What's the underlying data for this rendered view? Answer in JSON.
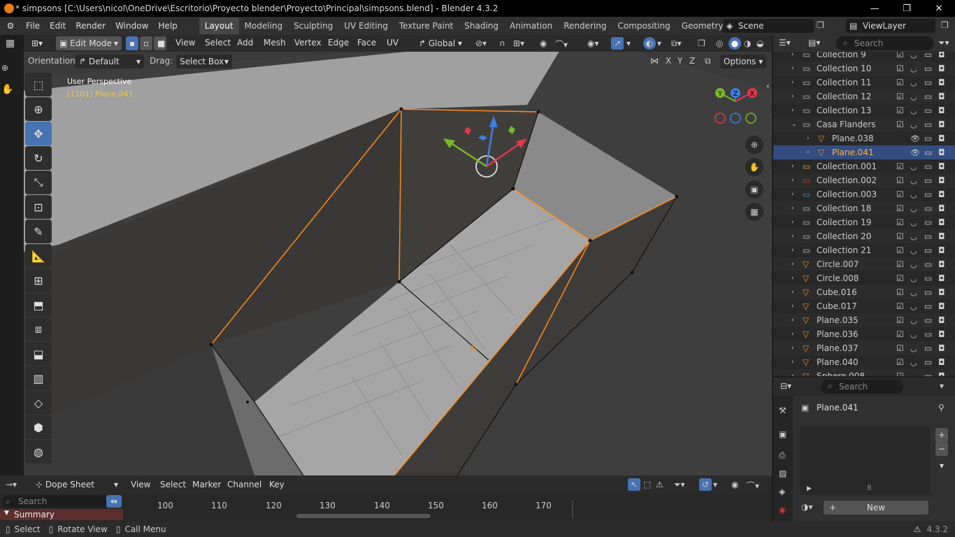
{
  "window": {
    "title": "* simpsons [C:\\Users\\nicol\\OneDrive\\Escritorio\\Proyecto blender\\Proyecto\\Principal\\simpsons.blend] - Blender 4.3.2"
  },
  "menu": [
    "File",
    "Edit",
    "Render",
    "Window",
    "Help"
  ],
  "workspaces": [
    "Layout",
    "Modeling",
    "Sculpting",
    "UV Editing",
    "Texture Paint",
    "Shading",
    "Animation",
    "Rendering",
    "Compositing",
    "Geometry Node"
  ],
  "scene": "Scene",
  "view_layer": "ViewLayer",
  "viewport": {
    "mode": "Edit Mode",
    "menus": [
      "View",
      "Select",
      "Add",
      "Mesh",
      "Vertex",
      "Edge",
      "Face",
      "UV"
    ],
    "transform_orientation": "Global",
    "orientation_label": "Orientation:",
    "orientation_value": "Default",
    "drag_label": "Drag:",
    "drag_value": "Select Box",
    "axes": [
      "X",
      "Y",
      "Z"
    ],
    "options_label": "Options",
    "perspective": "User Perspective",
    "object_info": "(1101) Plane.041"
  },
  "outliner": {
    "search_placeholder": "Search",
    "rows": [
      {
        "name": "Collection 9",
        "type": "collection"
      },
      {
        "name": "Collection 10",
        "type": "collection"
      },
      {
        "name": "Collection 11",
        "type": "collection"
      },
      {
        "name": "Collection 12",
        "type": "collection"
      },
      {
        "name": "Collection 13",
        "type": "collection"
      },
      {
        "name": "Casa Flanders",
        "type": "collection-open"
      },
      {
        "name": "Plane.038",
        "type": "mesh-child"
      },
      {
        "name": "Plane.041",
        "type": "mesh-child-selected"
      },
      {
        "name": "Collection.001",
        "type": "collection-yellow"
      },
      {
        "name": "Collection.002",
        "type": "collection-red"
      },
      {
        "name": "Collection.003",
        "type": "collection-blue"
      },
      {
        "name": "Collection 18",
        "type": "collection"
      },
      {
        "name": "Collection 19",
        "type": "collection"
      },
      {
        "name": "Collection 20",
        "type": "collection"
      },
      {
        "name": "Collection 21",
        "type": "collection"
      },
      {
        "name": "Circle.007",
        "type": "mesh"
      },
      {
        "name": "Circle.008",
        "type": "mesh"
      },
      {
        "name": "Cube.016",
        "type": "mesh"
      },
      {
        "name": "Cube.017",
        "type": "mesh"
      },
      {
        "name": "Plane.035",
        "type": "mesh"
      },
      {
        "name": "Plane.036",
        "type": "mesh"
      },
      {
        "name": "Plane.037",
        "type": "mesh"
      },
      {
        "name": "Plane.040",
        "type": "mesh"
      },
      {
        "name": "Sphere.008",
        "type": "mesh"
      }
    ]
  },
  "properties": {
    "search_placeholder": "Search",
    "object_name": "Plane.041",
    "new_button": "New"
  },
  "timeline": {
    "editor": "Dope Sheet",
    "menus": [
      "View",
      "Select",
      "Marker",
      "Channel",
      "Key"
    ],
    "search_placeholder": "Search",
    "frames": [
      "100",
      "110",
      "120",
      "130",
      "140",
      "150",
      "160",
      "170"
    ],
    "summary": "Summary"
  },
  "status": {
    "select": "Select",
    "rotate": "Rotate View",
    "call_menu": "Call Menu",
    "version": "4.3.2"
  },
  "colors": {
    "accent": "#4772b3",
    "selected_edge": "#ff8c1a",
    "brand": "#e87d0d"
  }
}
